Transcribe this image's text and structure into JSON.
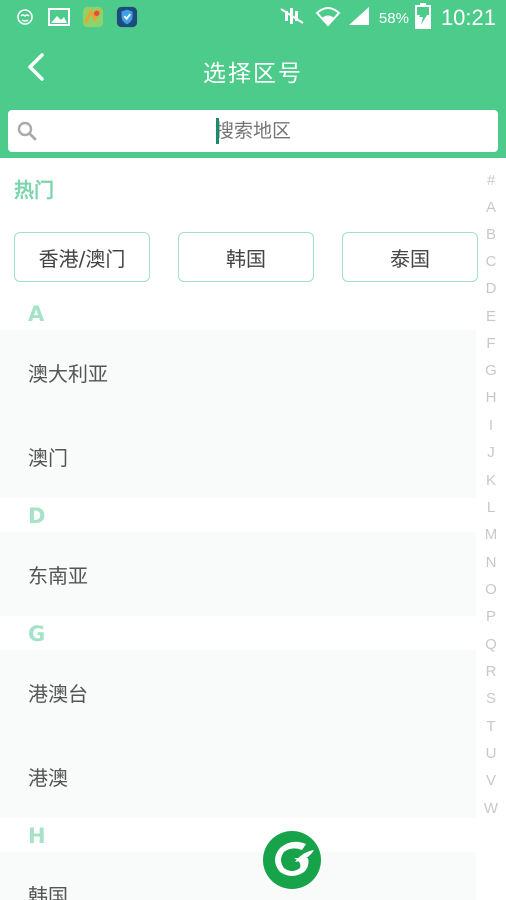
{
  "statusbar": {
    "battery_pct": "58%",
    "time": "10:21",
    "icons": [
      "notification-face-icon",
      "image-icon",
      "app-map-icon",
      "shield-icon",
      "mute-icon",
      "wifi-icon",
      "signal-icon",
      "battery-charging-icon"
    ]
  },
  "header": {
    "title": "选择区号",
    "back_icon": "chevron-left-icon"
  },
  "search": {
    "placeholder": "搜索地区",
    "icon": "search-icon"
  },
  "hot": {
    "title": "热门",
    "items": [
      "香港/澳门",
      "韩国",
      "泰国"
    ]
  },
  "sections": [
    {
      "letter": "A",
      "items": [
        "澳大利亚",
        "澳门"
      ]
    },
    {
      "letter": "D",
      "items": [
        "东南亚"
      ]
    },
    {
      "letter": "G",
      "items": [
        "港澳台",
        "港澳"
      ]
    },
    {
      "letter": "H",
      "items": [
        "韩国"
      ]
    }
  ],
  "index_letters": [
    "#",
    "A",
    "B",
    "C",
    "D",
    "E",
    "F",
    "G",
    "H",
    "I",
    "J",
    "K",
    "L",
    "M",
    "N",
    "O",
    "P",
    "Q",
    "R",
    "S",
    "T",
    "U",
    "V",
    "W"
  ],
  "colors": {
    "brand_green": "#4ccb8a",
    "section_letter": "#a5e3c6",
    "hot_border": "#9fe0c6",
    "logo_green": "#17a34a"
  }
}
